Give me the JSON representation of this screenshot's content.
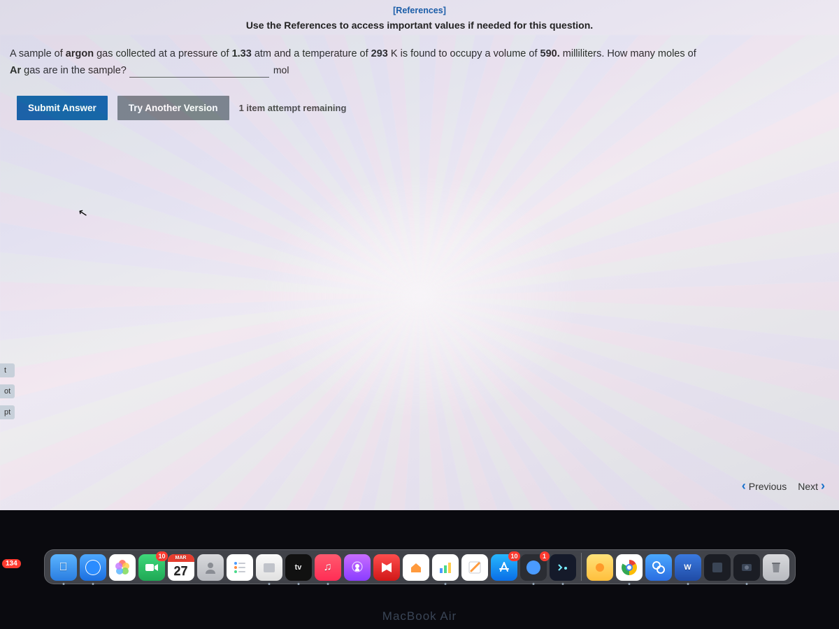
{
  "header": {
    "references_link": "[References]",
    "instruction": "Use the References to access important values if needed for this question."
  },
  "question": {
    "text_pre": "A sample of ",
    "gas_bold": "argon",
    "text_mid1": " gas collected at a pressure of ",
    "pressure": "1.33",
    "text_mid2": " atm and a temperature of ",
    "temperature": "293",
    "text_mid3": " K is found to occupy a volume of ",
    "volume": "590.",
    "text_mid4": " milliliters. How many moles of ",
    "element": "Ar",
    "text_end": " gas are in the sample?",
    "unit": "mol",
    "input_value": ""
  },
  "actions": {
    "submit": "Submit Answer",
    "try_another": "Try Another Version",
    "attempts": "1 item attempt remaining"
  },
  "left_tabs": [
    "t",
    "ot",
    "pt"
  ],
  "nav": {
    "prev": "Previous",
    "next": "Next"
  },
  "dock": {
    "calendar": {
      "month": "MAR",
      "day": "27",
      "badge": "10"
    },
    "appstore_badge": "10",
    "safari_badge": "1",
    "mail_badge": "134",
    "macbook": "MacBook Air",
    "tv": "tv",
    "word": "W"
  }
}
